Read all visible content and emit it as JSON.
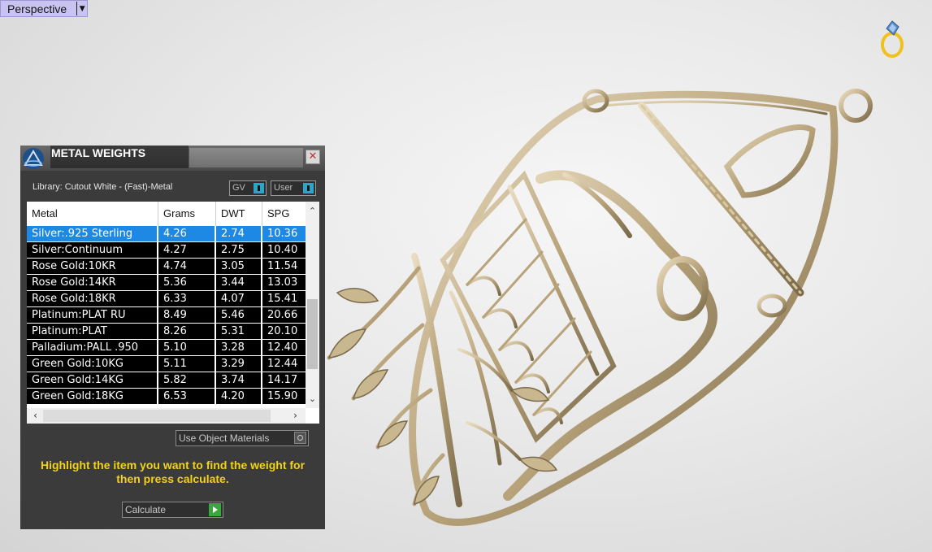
{
  "viewport": {
    "label": "Perspective",
    "menu_icon": "dropdown-arrow"
  },
  "corner_icon": "ring-icon",
  "panel": {
    "title": "METAL WEIGHTS",
    "logo_icon": "cad-logo-icon",
    "close_icon": "close-icon",
    "library_label": "Library: Cutout White - (Fast)-Metal",
    "toggles": [
      {
        "label": "GV"
      },
      {
        "label": "User"
      }
    ],
    "table": {
      "headers": [
        "Metal",
        "Grams",
        "DWT",
        "SPG"
      ],
      "selected_row": 0,
      "rows": [
        [
          "Silver:.925 Sterling",
          "4.26",
          "2.74",
          "10.36"
        ],
        [
          "Silver:Continuum",
          "4.27",
          "2.75",
          "10.40"
        ],
        [
          "Rose Gold:10KR",
          "4.74",
          "3.05",
          "11.54"
        ],
        [
          "Rose Gold:14KR",
          "5.36",
          "3.44",
          "13.03"
        ],
        [
          "Rose Gold:18KR",
          "6.33",
          "4.07",
          "15.41"
        ],
        [
          "Platinum:PLAT RU",
          "8.49",
          "5.46",
          "20.66"
        ],
        [
          "Platinum:PLAT",
          "8.26",
          "5.31",
          "20.10"
        ],
        [
          "Palladium:PALL .950",
          "5.10",
          "3.28",
          "12.40"
        ],
        [
          "Green Gold:10KG",
          "5.11",
          "3.29",
          "12.44"
        ],
        [
          "Green Gold:14KG",
          "5.82",
          "3.74",
          "14.17"
        ],
        [
          "Green Gold:18KG",
          "6.53",
          "4.20",
          "15.90"
        ]
      ]
    },
    "use_object_materials": "Use Object Materials",
    "hint": "Highlight the item you want to find the weight for then press calculate.",
    "calculate": "Calculate",
    "accent": "#1e88e5",
    "hint_color": "#f2d21a"
  }
}
